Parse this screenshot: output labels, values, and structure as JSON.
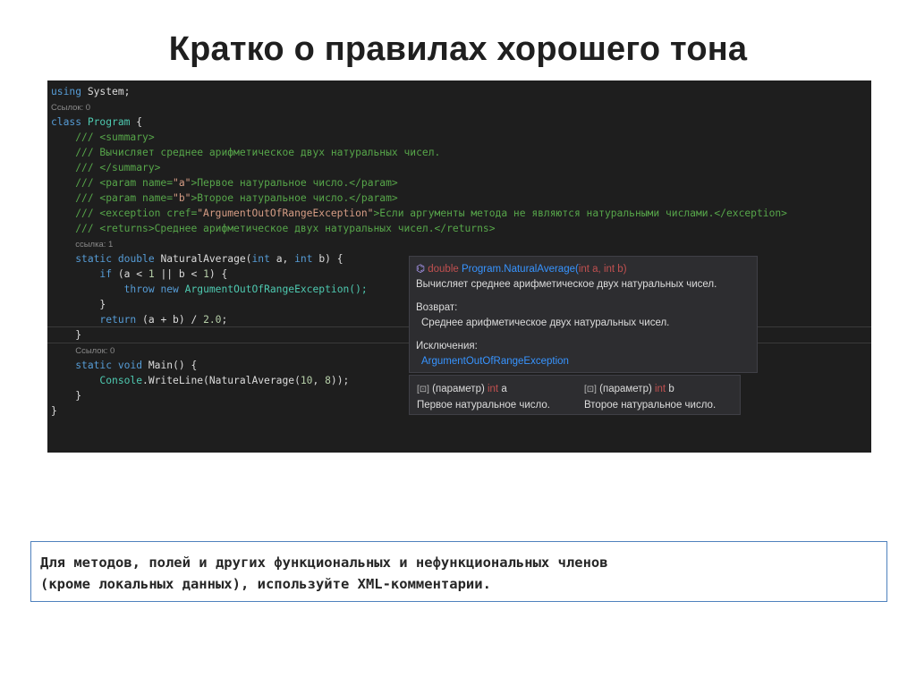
{
  "slide": {
    "title": "Кратко о правилах хорошего тона",
    "note_line1": "Для методов, полей и других функциональных и нефункциональных членов",
    "note_line2": "(кроме локальных данных), используйте XML-комментарии."
  },
  "code": {
    "l1_kw": "using",
    "l1_rest": " System;",
    "lens1": "Ссылок: 0",
    "l3_kw": "class",
    "l3_cls": "Program",
    "l3_rest": " {",
    "l4": "/// <summary>",
    "l5": "/// Вычисляет среднее арифметическое двух натуральных чисел.",
    "l6": "/// </summary>",
    "l7_a": "/// <param name=",
    "l7_s": "\"a\"",
    "l7_b": ">Первое натуральное число.</param>",
    "l8_a": "/// <param name=",
    "l8_s": "\"b\"",
    "l8_b": ">Второе натуральное число.</param>",
    "l9_a": "/// <exception cref=",
    "l9_s": "\"ArgumentOutOfRangeException\"",
    "l9_b": ">Если аргументы метода не являются натуральными числами.</exception>",
    "l10": "/// <returns>Среднее арифметическое двух натуральных чисел.</returns>",
    "lens2": "ссылка: 1",
    "l12_static": "static",
    "l12_double": "double",
    "l12_name": " NaturalAverage(",
    "l12_int1": "int",
    "l12_a": " a, ",
    "l12_int2": "int",
    "l12_b": " b) {",
    "l13_if": "if",
    "l13_rest": " (a < ",
    "l13_n1": "1",
    "l13_mid": " || b < ",
    "l13_n2": "1",
    "l13_end": ") {",
    "l14_throw": "throw",
    "l14_new": "new",
    "l14_cls": " ArgumentOutOfRangeException();",
    "l15": "}",
    "l16_return": "return",
    "l16_rest": " (a + b) / ",
    "l16_num": "2.0",
    "l16_end": ";",
    "l17": "}",
    "lens3": "Ссылок: 0",
    "l19_static": "static",
    "l19_void": "void",
    "l19_rest": " Main() {",
    "l20_cls": "Console",
    "l20_a": ".WriteLine(NaturalAverage(",
    "l20_n1": "10",
    "l20_c": ", ",
    "l20_n2": "8",
    "l20_end": "));",
    "l21": "}",
    "l22": "}"
  },
  "tooltip": {
    "sig_icon": "⌬",
    "sig_double": "double",
    "sig_name": " Program.NaturalAverage(",
    "sig_int1": "int",
    "sig_a": " a, ",
    "sig_int2": "int",
    "sig_b": " b)",
    "summary": "Вычисляет среднее арифметическое двух натуральных чисел.",
    "returns_label": "Возврат:",
    "returns_text": "Среднее арифметическое двух натуральных чисел.",
    "exceptions_label": "Исключения:",
    "exception_link": "ArgumentOutOfRangeException"
  },
  "params": {
    "p1_icon": "[⊡]",
    "p1_label": " (параметр) ",
    "p1_type": "int",
    "p1_name": " a",
    "p1_desc": "Первое натуральное число.",
    "p2_icon": "[⊡]",
    "p2_label": " (параметр) ",
    "p2_type": "int",
    "p2_name": " b",
    "p2_desc": "Второе натуральное число."
  },
  "colors": {
    "keyword": "#569cd6",
    "type": "#4ec9b0",
    "string": "#d69d85",
    "comment": "#57a64a",
    "link": "#3794ff",
    "border": "#4f81bd"
  }
}
